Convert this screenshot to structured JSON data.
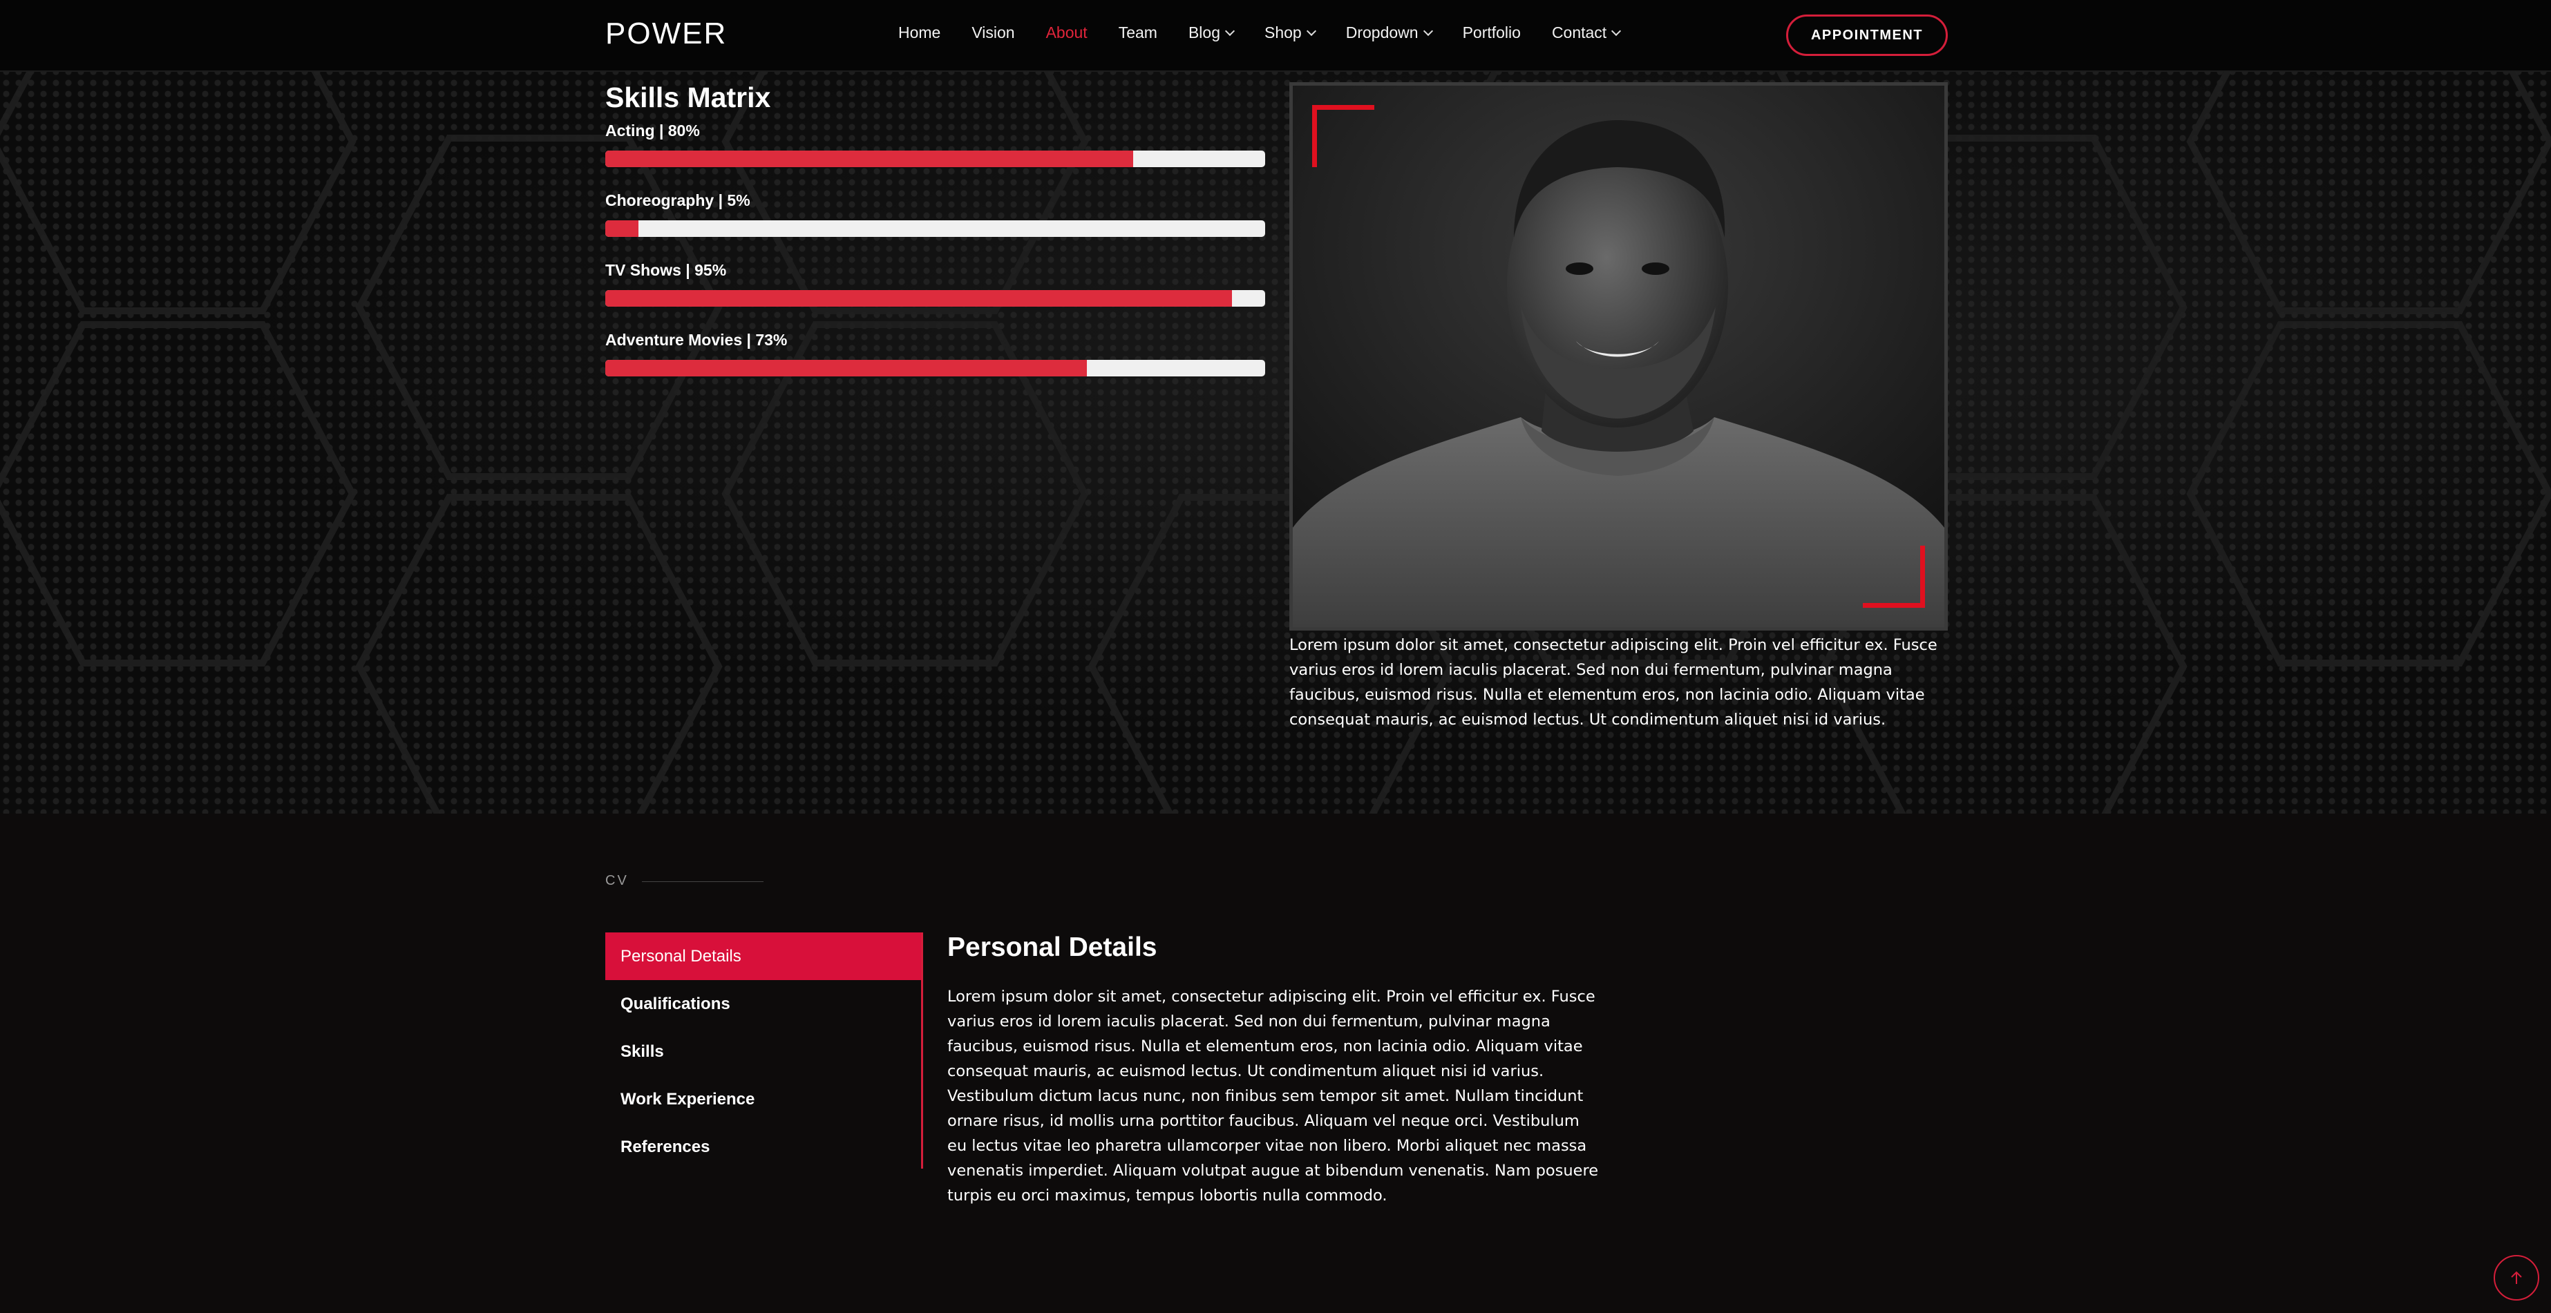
{
  "header": {
    "logo": "POWER",
    "nav": [
      {
        "label": "Home",
        "active": false,
        "dropdown": false
      },
      {
        "label": "Vision",
        "active": false,
        "dropdown": false
      },
      {
        "label": "About",
        "active": true,
        "dropdown": false
      },
      {
        "label": "Team",
        "active": false,
        "dropdown": false
      },
      {
        "label": "Blog",
        "active": false,
        "dropdown": true
      },
      {
        "label": "Shop",
        "active": false,
        "dropdown": true
      },
      {
        "label": "Dropdown",
        "active": false,
        "dropdown": true
      },
      {
        "label": "Portfolio",
        "active": false,
        "dropdown": false
      },
      {
        "label": "Contact",
        "active": false,
        "dropdown": true
      }
    ],
    "appointment_label": "APPOINTMENT"
  },
  "skills": {
    "title": "Skills Matrix",
    "items": [
      {
        "label": "Acting | 80%",
        "percent": 80
      },
      {
        "label": "Choreography | 5%",
        "percent": 5
      },
      {
        "label": "TV Shows | 95%",
        "percent": 95
      },
      {
        "label": "Adventure Movies | 73%",
        "percent": 73
      }
    ]
  },
  "portrait": {
    "bio": "Lorem ipsum dolor sit amet, consectetur adipiscing elit. Proin vel efficitur ex. Fusce varius eros id lorem iaculis placerat. Sed non dui fermentum, pulvinar magna faucibus, euismod risus. Nulla et elementum eros, non lacinia odio. Aliquam vitae consequat mauris, ac euismod lectus. Ut condimentum aliquet nisi id varius."
  },
  "cv": {
    "section_label": "CV",
    "tabs": [
      {
        "label": "Personal Details",
        "active": true
      },
      {
        "label": "Qualifications",
        "active": false
      },
      {
        "label": "Skills",
        "active": false
      },
      {
        "label": "Work Experience",
        "active": false
      },
      {
        "label": "References",
        "active": false
      }
    ],
    "heading": "Personal Details",
    "body": "Lorem ipsum dolor sit amet, consectetur adipiscing elit. Proin vel efficitur ex. Fusce varius eros id lorem iaculis placerat. Sed non dui fermentum, pulvinar magna faucibus, euismod risus. Nulla et elementum eros, non lacinia odio. Aliquam vitae consequat mauris, ac euismod lectus. Ut condimentum aliquet nisi id varius. Vestibulum dictum lacus nunc, non finibus sem tempor sit amet. Nullam tincidunt ornare risus, id mollis urna porttitor faucibus. Aliquam vel neque orci. Vestibulum eu lectus vitae leo pharetra ullamcorper vitae non libero. Morbi aliquet nec massa venenatis imperdiet. Aliquam volutpat augue at bibendum venenatis. Nam posuere turpis eu orci maximus, tempus lobortis nulla commodo."
  },
  "colors": {
    "accent": "#dd2c3d",
    "bar_track": "#f0f0f0",
    "background": "#0d0b0b"
  },
  "icons": {
    "scroll_top": "arrow-up-icon",
    "nav_dropdown": "chevron-down-icon"
  }
}
